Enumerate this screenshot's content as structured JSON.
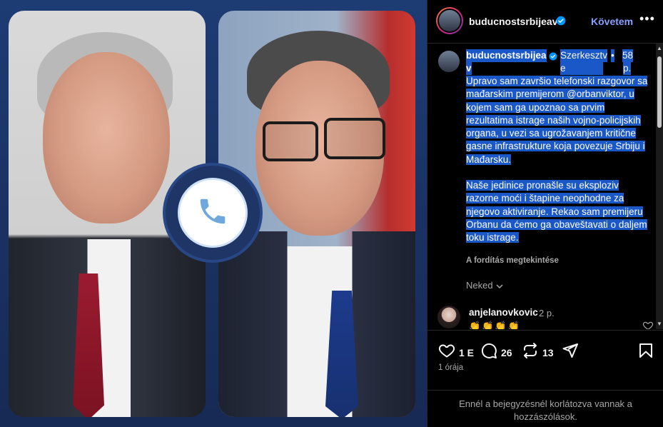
{
  "header": {
    "username": "buducnostsrbijeav",
    "follow_label": "Követem",
    "more_label": "•••"
  },
  "caption": {
    "username": "buducnostsrbijea",
    "username_cont": "v",
    "meta_role": "Szerkesztv",
    "meta_role_cont": "e",
    "meta_dot": "•",
    "meta_time": "58",
    "meta_time_unit": "p.",
    "paragraph1": "Upravo sam završio telefonski razgovor sa mađarskim premijerom @orbanviktor, u kojem sam ga upoznao sa prvim rezultatima istrage naših vojno-policijskih organa, u vezi sa ugrožavanjem kritične gasne infrastrukture koja povezuje Srbiju i Mađarsku.",
    "paragraph2": "Naše jedinice pronašle su eksploziv razorne moći i štapine neophodne za njegovo aktiviranje. Rekao sam premijeru Orbanu da ćemo ga obaveštavati o daljem toku istrage.",
    "see_translation": "A fordítás megtekintése"
  },
  "more_replies": "Neked",
  "comment": {
    "username": "anjelanovkovic",
    "time": "2 p.",
    "text": "👏👏👏👏"
  },
  "actions": {
    "likes": "1 E",
    "comments": "26",
    "reposts": "13"
  },
  "timestamp": "1 órája",
  "comments_disabled_line1": "Ennél a bejegyzésnél korlátozva vannak a",
  "comments_disabled_line2": "hozzászólások.",
  "colors": {
    "accent_blue": "#85a1ff",
    "verified_blue": "#0095f6",
    "selection": "#1a57c7",
    "media_bg": "#1d3c74"
  },
  "icons": [
    "verified-badge-icon",
    "phone-icon",
    "heart-icon",
    "comment-icon",
    "repost-icon",
    "share-icon",
    "bookmark-icon",
    "chevron-down-icon"
  ]
}
